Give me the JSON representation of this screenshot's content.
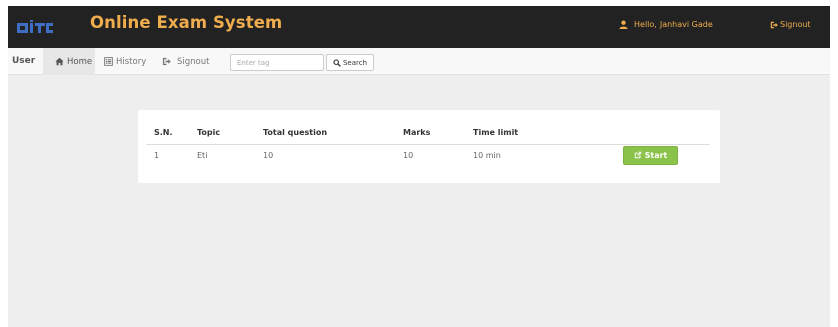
{
  "header": {
    "brand_title": "Online Exam System",
    "logo_icon": "college-logo-icon",
    "greeting": "Hello,",
    "user_name": "Janhavi Gade",
    "signout_label": "Signout",
    "accent_color": "#f0ad4e",
    "background_color": "#222222"
  },
  "nav": {
    "brand_label": "User",
    "items": [
      {
        "label": "Home",
        "icon": "home-icon",
        "active": true
      },
      {
        "label": "History",
        "icon": "history-list-icon",
        "active": false
      },
      {
        "label": "Signout",
        "icon": "signout-icon",
        "active": false
      }
    ],
    "search": {
      "placeholder": "Enter tag",
      "button_label": "Search",
      "button_icon": "search-icon"
    }
  },
  "exam_table": {
    "columns": [
      "S.N.",
      "Topic",
      "Total question",
      "Marks",
      "Time limit"
    ],
    "rows": [
      {
        "sn": "1",
        "topic": "Eti",
        "total_question": "10",
        "marks": "10",
        "time_limit": "10 min",
        "action_label": "Start",
        "action_icon": "external-link-icon"
      }
    ],
    "action_color": "#8bc34a"
  }
}
